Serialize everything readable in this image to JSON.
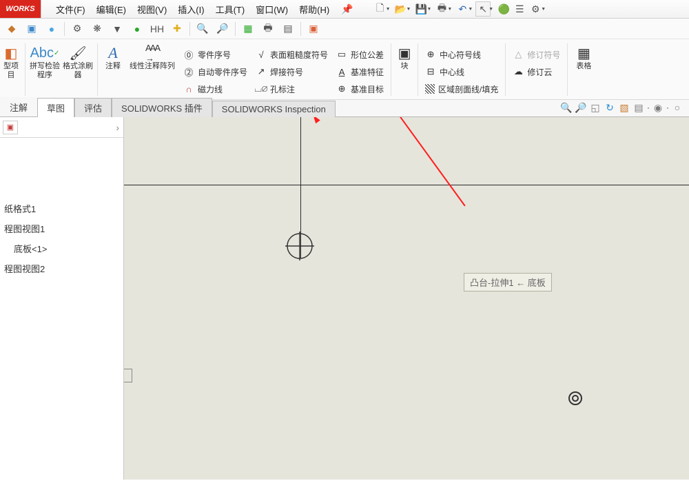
{
  "logo": "WORKS",
  "menu": {
    "file": "文件(F)",
    "edit": "编辑(E)",
    "view": "视图(V)",
    "insert": "插入(I)",
    "tools": "工具(T)",
    "window": "窗口(W)",
    "help": "帮助(H)"
  },
  "ribbon": {
    "modelitem": "型项目",
    "spellcheck": "拼写检验程序",
    "formatbrush": "格式涂刷器",
    "note": "注释",
    "linearpat": "线性注释阵列",
    "partno": "零件序号",
    "autopartno": "自动零件序号",
    "magline": "磁力线",
    "surfrough": "表面粗糙度符号",
    "weldsym": "焊接符号",
    "holeannot": "孔标注",
    "geotol": "形位公差",
    "datumfeat": "基准特征",
    "datumtarget": "基准目标",
    "block": "块",
    "centersym": "中心符号线",
    "centerline": "中心线",
    "hatch": "区域剖面线/填充",
    "revsym": "修订符号",
    "revcloud": "修订云",
    "table": "表格"
  },
  "tabs": {
    "note": "注解",
    "sketch": "草图",
    "eval": "评估",
    "addons": "SOLIDWORKS 插件",
    "insp": "SOLIDWORKS Inspection"
  },
  "tree": {
    "fmt": "纸格式1",
    "view1": "程图视图1",
    "base": "底板<1>",
    "view2": "程图视图2"
  },
  "tooltip": "凸台-拉伸1 ← 底板"
}
